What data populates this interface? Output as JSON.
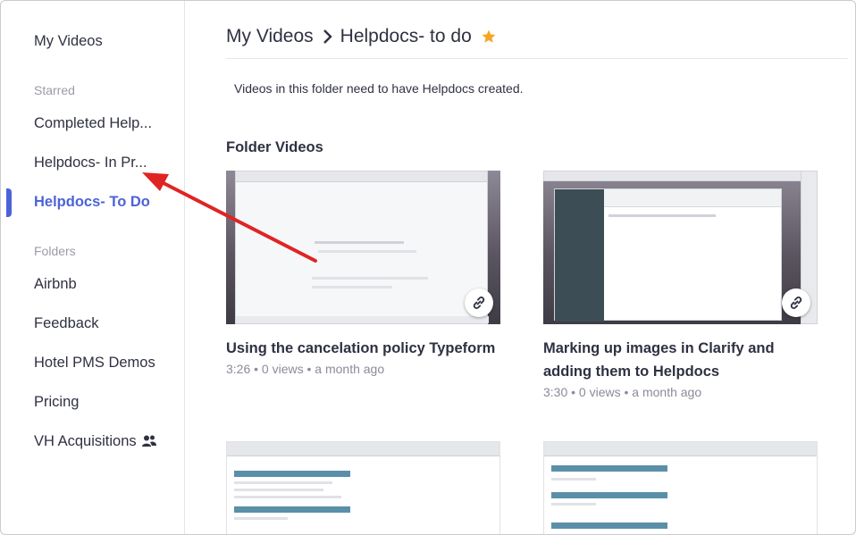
{
  "sidebar": {
    "my_videos": "My Videos",
    "starred_heading": "Starred",
    "starred": [
      "Completed Help...",
      "Helpdocs- In Pr...",
      "Helpdocs- To Do"
    ],
    "folders_heading": "Folders",
    "folders": [
      "Airbnb",
      "Feedback",
      "Hotel PMS Demos",
      "Pricing",
      "VH Acquisitions"
    ],
    "accent_color": "#4c63d8"
  },
  "header": {
    "root": "My Videos",
    "current": "Helpdocs- to do",
    "star_color": "#f5a623"
  },
  "main": {
    "description": "Videos in this folder need to have Helpdocs created.",
    "section_title": "Folder Videos",
    "videos": [
      {
        "title": "Using the cancelation policy Typeform",
        "meta": "3:26 • 0 views • a month ago"
      },
      {
        "title": "Marking up images in Clarify and adding them to Helpdocs",
        "meta": "3:30 • 0 views • a month ago"
      },
      {
        "title": "",
        "meta": ""
      },
      {
        "title": "",
        "meta": ""
      }
    ]
  },
  "annotation": {
    "arrow_color": "#e02424"
  }
}
